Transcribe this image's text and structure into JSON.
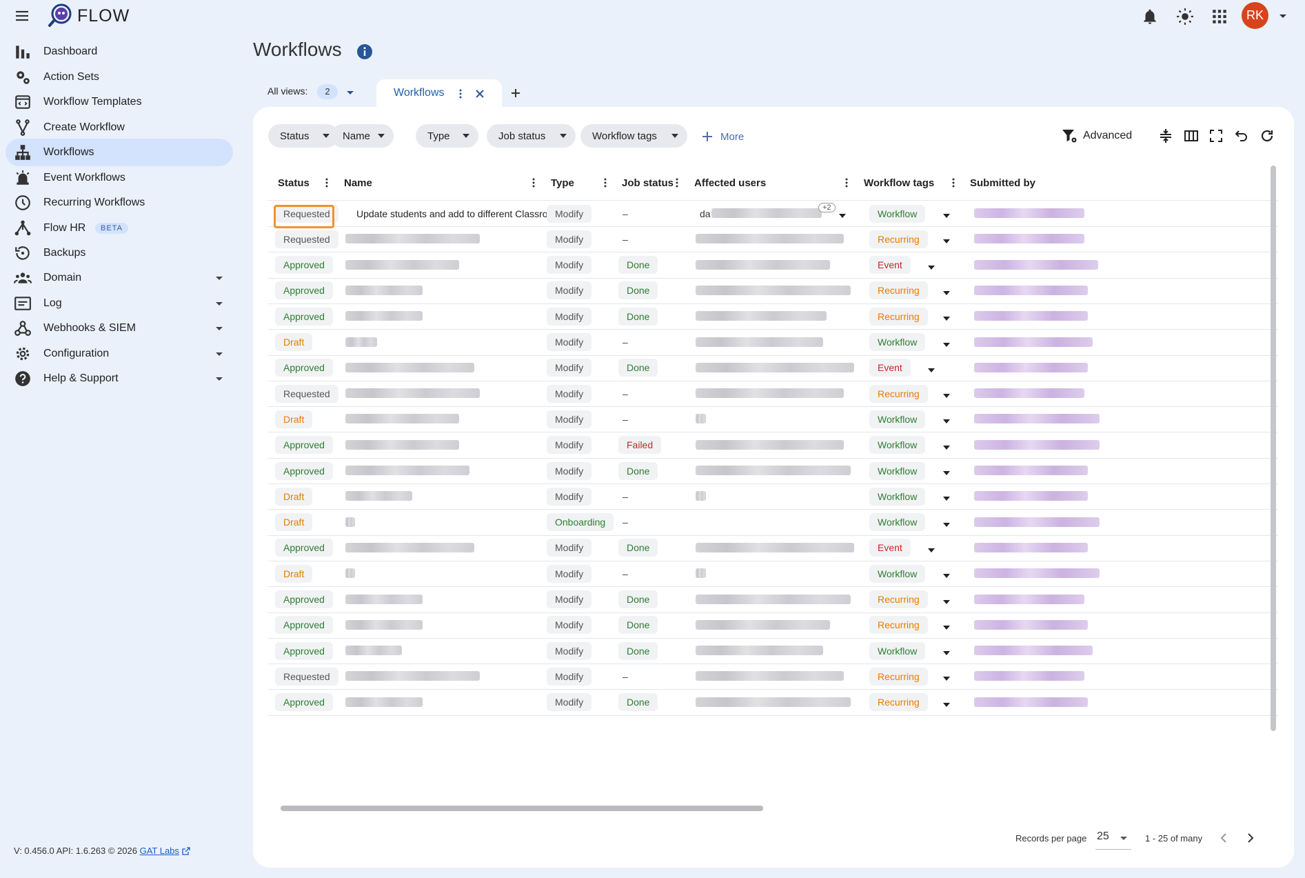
{
  "app": {
    "brand": "FLOW"
  },
  "user": {
    "initials": "RK",
    "avatar_color": "#d7441c"
  },
  "sidebar": {
    "items": [
      {
        "label": "Dashboard",
        "icon": "bar-chart-icon"
      },
      {
        "label": "Action Sets",
        "icon": "gears-icon"
      },
      {
        "label": "Workflow Templates",
        "icon": "template-icon"
      },
      {
        "label": "Create Workflow",
        "icon": "fork-icon"
      },
      {
        "label": "Workflows",
        "icon": "hierarchy-icon",
        "active": true
      },
      {
        "label": "Event Workflows",
        "icon": "alarm-icon"
      },
      {
        "label": "Recurring Workflows",
        "icon": "clock-icon"
      },
      {
        "label": "Flow HR",
        "icon": "flow-hr-icon",
        "badge": "BETA"
      },
      {
        "label": "Backups",
        "icon": "history-icon"
      },
      {
        "label": "Domain",
        "icon": "people-icon",
        "expandable": true
      },
      {
        "label": "Log",
        "icon": "log-icon",
        "expandable": true
      },
      {
        "label": "Webhooks & SIEM",
        "icon": "webhook-icon",
        "expandable": true
      },
      {
        "label": "Configuration",
        "icon": "gear-icon",
        "expandable": true
      },
      {
        "label": "Help & Support",
        "icon": "help-icon",
        "expandable": true
      }
    ]
  },
  "footer": {
    "version": "V: 0.456.0  API: 1.6.263  © 2026",
    "link": "GAT Labs"
  },
  "page": {
    "title": "Workflows"
  },
  "views": {
    "label": "All views:",
    "count": "2",
    "tab_label": "Workflows"
  },
  "filters": {
    "chips": [
      "Status",
      "Name",
      "Type",
      "Job status",
      "Workflow tags"
    ],
    "more": "More",
    "advanced": "Advanced"
  },
  "table": {
    "columns": [
      "Status",
      "Name",
      "Type",
      "Job status",
      "Affected users",
      "Workflow tags",
      "Submitted by"
    ],
    "first_row_name": "Update students and add to different Classroo...",
    "first_row_user_prefix": "da",
    "first_row_user_extra": "+2",
    "rows": [
      {
        "status": "Requested",
        "type": "Modify",
        "job": "–",
        "tag": "Workflow"
      },
      {
        "status": "Requested",
        "type": "Modify",
        "job": "–",
        "tag": "Recurring"
      },
      {
        "status": "Approved",
        "type": "Modify",
        "job": "Done",
        "tag": "Event"
      },
      {
        "status": "Approved",
        "type": "Modify",
        "job": "Done",
        "tag": "Recurring"
      },
      {
        "status": "Approved",
        "type": "Modify",
        "job": "Done",
        "tag": "Recurring"
      },
      {
        "status": "Draft",
        "type": "Modify",
        "job": "–",
        "tag": "Workflow"
      },
      {
        "status": "Approved",
        "type": "Modify",
        "job": "Done",
        "tag": "Event"
      },
      {
        "status": "Requested",
        "type": "Modify",
        "job": "–",
        "tag": "Recurring"
      },
      {
        "status": "Draft",
        "type": "Modify",
        "job": "–",
        "tag": "Workflow"
      },
      {
        "status": "Approved",
        "type": "Modify",
        "job": "Failed",
        "tag": "Workflow"
      },
      {
        "status": "Approved",
        "type": "Modify",
        "job": "Done",
        "tag": "Workflow"
      },
      {
        "status": "Draft",
        "type": "Modify",
        "job": "–",
        "tag": "Workflow"
      },
      {
        "status": "Draft",
        "type": "Onboarding",
        "job": "–",
        "tag": "Workflow"
      },
      {
        "status": "Approved",
        "type": "Modify",
        "job": "Done",
        "tag": "Event"
      },
      {
        "status": "Draft",
        "type": "Modify",
        "job": "–",
        "tag": "Workflow"
      },
      {
        "status": "Approved",
        "type": "Modify",
        "job": "Done",
        "tag": "Recurring"
      },
      {
        "status": "Approved",
        "type": "Modify",
        "job": "Done",
        "tag": "Recurring"
      },
      {
        "status": "Approved",
        "type": "Modify",
        "job": "Done",
        "tag": "Workflow"
      },
      {
        "status": "Requested",
        "type": "Modify",
        "job": "–",
        "tag": "Recurring"
      },
      {
        "status": "Approved",
        "type": "Modify",
        "job": "Done",
        "tag": "Recurring"
      }
    ]
  },
  "pagination": {
    "label": "Records per page",
    "size": "25",
    "range": "1 - 25 of many"
  },
  "colors": {
    "approved": "#2e7d32",
    "draft": "#e67c00",
    "failed": "#c62828",
    "accent": "#1f5fa8",
    "active_nav": "#d3e3fd"
  }
}
